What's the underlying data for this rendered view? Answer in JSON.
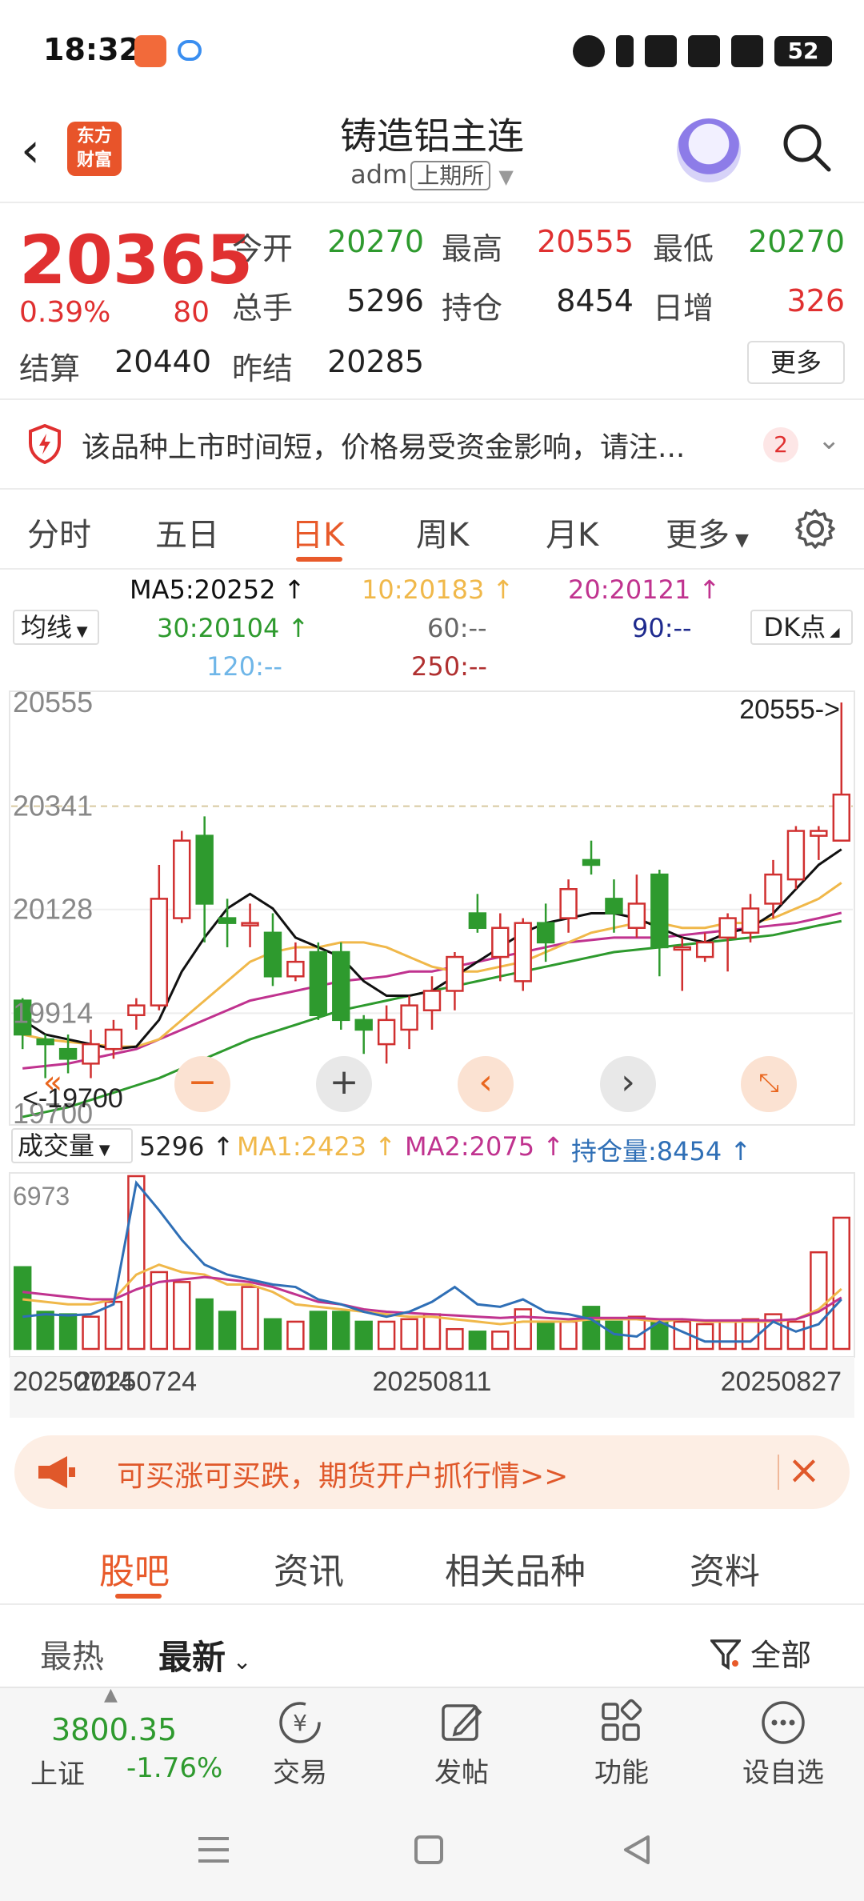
{
  "status_bar": {
    "time": "18:32",
    "battery": "52"
  },
  "header": {
    "title": "铸造铝主连",
    "code": "adm",
    "exchange": "上期所"
  },
  "quote": {
    "price": "20365",
    "change_pct": "0.39%",
    "change": "80",
    "fields": [
      {
        "label": "今开",
        "value": "20270",
        "color": "green"
      },
      {
        "label": "最高",
        "value": "20555",
        "color": "red"
      },
      {
        "label": "最低",
        "value": "20270",
        "color": "green"
      },
      {
        "label": "总手",
        "value": "5296",
        "color": "black"
      },
      {
        "label": "持仓",
        "value": "8454",
        "color": "black"
      },
      {
        "label": "日增",
        "value": "326",
        "color": "red"
      },
      {
        "label": "结算",
        "value": "20440",
        "color": "black"
      },
      {
        "label": "昨结",
        "value": "20285",
        "color": "black"
      }
    ],
    "more_label": "更多"
  },
  "notice": {
    "text": "该品种上市时间短，价格易受资金影响，请注...",
    "count": "2"
  },
  "tabs": [
    "分时",
    "五日",
    "日K",
    "周K",
    "月K",
    "更多"
  ],
  "active_tab": "日K",
  "ma_legend": {
    "selector": "均线",
    "dk_label": "DK点",
    "items": [
      {
        "text": "MA5:20252 ↑",
        "color": "#111111"
      },
      {
        "text": "10:20183 ↑",
        "color": "#f0b84a"
      },
      {
        "text": "20:20121 ↑",
        "color": "#c0338f"
      },
      {
        "text": "30:20104 ↑",
        "color": "#2e9a2e"
      },
      {
        "text": "60:--",
        "color": "#666666"
      },
      {
        "text": "90:--",
        "color": "#1e2a8e"
      },
      {
        "text": "120:--",
        "color": "#6fb6e8"
      },
      {
        "text": "250:--",
        "color": "#b03030"
      }
    ]
  },
  "chart_data": {
    "type": "candlestick",
    "y_ticks": [
      "20555",
      "20341",
      "20128",
      "19914",
      "19700"
    ],
    "ylim": [
      19700,
      20555
    ],
    "max_label": "20555->",
    "min_label": "<-19700",
    "x_labels": [
      "20250714",
      "20250724",
      "20250811",
      "20250827"
    ],
    "candles": [
      {
        "o": 19940,
        "c": 19870,
        "h": 19945,
        "l": 19840
      },
      {
        "o": 19860,
        "c": 19850,
        "h": 19870,
        "l": 19780
      },
      {
        "o": 19840,
        "c": 19820,
        "h": 19870,
        "l": 19790
      },
      {
        "o": 19810,
        "c": 19850,
        "h": 19880,
        "l": 19780
      },
      {
        "o": 19840,
        "c": 19880,
        "h": 19900,
        "l": 19820
      },
      {
        "o": 19910,
        "c": 19930,
        "h": 19945,
        "l": 19880
      },
      {
        "o": 19930,
        "c": 20150,
        "h": 20220,
        "l": 19920
      },
      {
        "o": 20110,
        "c": 20270,
        "h": 20290,
        "l": 20100
      },
      {
        "o": 20280,
        "c": 20140,
        "h": 20320,
        "l": 20060
      },
      {
        "o": 20110,
        "c": 20100,
        "h": 20150,
        "l": 20050
      },
      {
        "o": 20100,
        "c": 20100,
        "h": 20140,
        "l": 20050
      },
      {
        "o": 20080,
        "c": 19990,
        "h": 20120,
        "l": 19970
      },
      {
        "o": 19990,
        "c": 20020,
        "h": 20060,
        "l": 19980
      },
      {
        "o": 20040,
        "c": 19910,
        "h": 20060,
        "l": 19900
      },
      {
        "o": 20040,
        "c": 19900,
        "h": 20060,
        "l": 19880
      },
      {
        "o": 19900,
        "c": 19880,
        "h": 19910,
        "l": 19830
      },
      {
        "o": 19850,
        "c": 19900,
        "h": 19930,
        "l": 19810
      },
      {
        "o": 19880,
        "c": 19930,
        "h": 19950,
        "l": 19840
      },
      {
        "o": 19920,
        "c": 19960,
        "h": 19990,
        "l": 19880
      },
      {
        "o": 19960,
        "c": 20030,
        "h": 20040,
        "l": 19920
      },
      {
        "o": 20120,
        "c": 20090,
        "h": 20160,
        "l": 20080
      },
      {
        "o": 20030,
        "c": 20090,
        "h": 20120,
        "l": 19980
      },
      {
        "o": 19980,
        "c": 20100,
        "h": 20110,
        "l": 19960
      },
      {
        "o": 20100,
        "c": 20060,
        "h": 20140,
        "l": 20020
      },
      {
        "o": 20110,
        "c": 20170,
        "h": 20190,
        "l": 20080
      },
      {
        "o": 20230,
        "c": 20220,
        "h": 20270,
        "l": 20200
      },
      {
        "o": 20150,
        "c": 20120,
        "h": 20190,
        "l": 20080
      },
      {
        "o": 20090,
        "c": 20140,
        "h": 20200,
        "l": 20070
      },
      {
        "o": 20200,
        "c": 20050,
        "h": 20210,
        "l": 19990
      },
      {
        "o": 20050,
        "c": 20050,
        "h": 20070,
        "l": 19960
      },
      {
        "o": 20030,
        "c": 20060,
        "h": 20080,
        "l": 20020
      },
      {
        "o": 20070,
        "c": 20110,
        "h": 20120,
        "l": 20000
      },
      {
        "o": 20080,
        "c": 20130,
        "h": 20160,
        "l": 20060
      },
      {
        "o": 20140,
        "c": 20200,
        "h": 20230,
        "l": 20110
      },
      {
        "o": 20190,
        "c": 20290,
        "h": 20300,
        "l": 20170
      },
      {
        "o": 20280,
        "c": 20290,
        "h": 20300,
        "l": 20230
      },
      {
        "o": 20270,
        "c": 20365,
        "h": 20555,
        "l": 20270
      }
    ],
    "ma5": [
      19900,
      19870,
      19860,
      19850,
      19840,
      19845,
      19900,
      20000,
      20070,
      20130,
      20160,
      20130,
      20070,
      20050,
      20030,
      19980,
      19950,
      19950,
      19960,
      19990,
      20020,
      20050,
      20080,
      20100,
      20110,
      20120,
      20120,
      20110,
      20090,
      20070,
      20060,
      20080,
      20090,
      20120,
      20170,
      20220,
      20252
    ],
    "ma10": [
      19870,
      19860,
      19855,
      19850,
      19845,
      19845,
      19860,
      19900,
      19940,
      19980,
      20020,
      20040,
      20050,
      20050,
      20060,
      20060,
      20050,
      20030,
      20010,
      20000,
      20000,
      20010,
      20020,
      20040,
      20060,
      20080,
      20090,
      20100,
      20100,
      20090,
      20090,
      20100,
      20100,
      20110,
      20130,
      20150,
      20183
    ],
    "ma20": [
      19800,
      19805,
      19810,
      19820,
      19830,
      19840,
      19860,
      19880,
      19900,
      19920,
      19940,
      19950,
      19960,
      19970,
      19980,
      19985,
      19990,
      20000,
      20000,
      20010,
      20020,
      20030,
      20040,
      20050,
      20060,
      20065,
      20070,
      20070,
      20070,
      20075,
      20080,
      20085,
      20090,
      20095,
      20100,
      20110,
      20121
    ],
    "ma30": [
      19700,
      19710,
      19720,
      19735,
      19750,
      19765,
      19780,
      19800,
      19820,
      19840,
      19860,
      19875,
      19890,
      19905,
      19920,
      19930,
      19940,
      19950,
      19960,
      19970,
      19980,
      19990,
      20000,
      20010,
      20020,
      20030,
      20040,
      20045,
      20050,
      20055,
      20060,
      20065,
      20070,
      20075,
      20085,
      20095,
      20104
    ],
    "volume": {
      "selector": "成交量",
      "value_label": "5296 ↑",
      "ma1_label": "MA1:2423 ↑",
      "ma2_label": "MA2:2075 ↑",
      "oi_label": "持仓量:8454 ↑",
      "top_label": "6973",
      "ylim": [
        0,
        6973
      ],
      "bars": [
        3300,
        1500,
        1400,
        1300,
        1900,
        6973,
        3100,
        2700,
        2000,
        1500,
        2500,
        1200,
        1100,
        1500,
        1500,
        1100,
        1100,
        1200,
        1400,
        800,
        700,
        700,
        1600,
        1100,
        1100,
        1700,
        1100,
        1300,
        1100,
        1100,
        1000,
        1100,
        1200,
        1400,
        1100,
        3900,
        5296
      ],
      "ma1": [
        2000,
        1900,
        1800,
        1800,
        2000,
        3000,
        3400,
        3100,
        3000,
        2600,
        2600,
        2300,
        1800,
        1700,
        1600,
        1500,
        1400,
        1300,
        1300,
        1200,
        1100,
        1000,
        1100,
        1100,
        1100,
        1200,
        1200,
        1200,
        1100,
        1200,
        1100,
        1100,
        1100,
        1100,
        1200,
        1600,
        2423
      ],
      "ma2": [
        2300,
        2200,
        2100,
        2000,
        2000,
        2400,
        2700,
        2800,
        2900,
        2800,
        2700,
        2500,
        2200,
        1900,
        1800,
        1600,
        1500,
        1450,
        1400,
        1350,
        1300,
        1250,
        1300,
        1250,
        1200,
        1250,
        1250,
        1250,
        1200,
        1200,
        1150,
        1150,
        1150,
        1150,
        1200,
        1500,
        2075
      ],
      "oi": [
        1300,
        1400,
        1350,
        1400,
        1800,
        6700,
        5600,
        4400,
        3400,
        3000,
        2800,
        2600,
        2500,
        2000,
        1800,
        1500,
        1300,
        1500,
        1900,
        2500,
        1800,
        1700,
        2000,
        1500,
        1400,
        1200,
        600,
        500,
        1100,
        700,
        300,
        300,
        300,
        1100,
        700,
        1000,
        2000
      ]
    }
  },
  "ad": {
    "text": "可买涨可买跌，期货开户抓行情>>"
  },
  "community_tabs": [
    "股吧",
    "资讯",
    "相关品种",
    "资料"
  ],
  "sort": {
    "hot": "最热",
    "new": "最新",
    "filter": "全部"
  },
  "bottom_nav": {
    "index_value": "3800.35",
    "index_name": "上证",
    "index_pct": "-1.76%",
    "items": [
      "交易",
      "发帖",
      "功能",
      "设自选"
    ]
  }
}
